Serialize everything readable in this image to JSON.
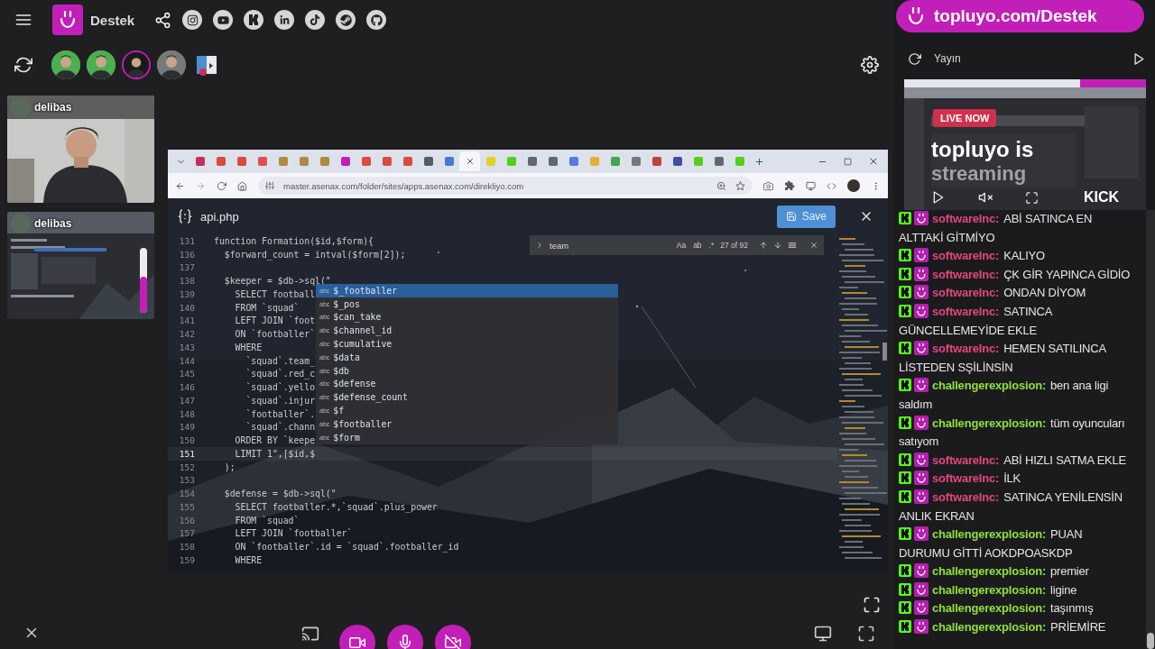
{
  "topbar": {
    "server_name": "Destek",
    "social_links": [
      {
        "kind": "camera"
      },
      {
        "kind": "play"
      },
      {
        "kind": "k"
      },
      {
        "kind": "in"
      },
      {
        "kind": "note"
      },
      {
        "kind": "steam"
      },
      {
        "kind": "cat"
      }
    ]
  },
  "avatars": [
    {
      "kind": "person",
      "selected": false
    },
    {
      "kind": "person",
      "selected": false
    },
    {
      "kind": "person",
      "selected": true
    },
    {
      "kind": "person",
      "selected": false
    },
    {
      "kind": "app",
      "selected": false
    }
  ],
  "video_tiles": [
    {
      "name": "delibas",
      "kind": "camera"
    },
    {
      "name": "delibas",
      "kind": "screen",
      "volume": {
        "level": 0.55
      }
    }
  ],
  "browser": {
    "tabs": [
      {
        "color": "#c0305a",
        "selected": false
      },
      {
        "color": "#d94b3b",
        "selected": false
      },
      {
        "color": "#d94b3b",
        "selected": false
      },
      {
        "color": "#e05050",
        "selected": false
      },
      {
        "color": "#b08a40",
        "selected": false
      },
      {
        "color": "#b08a40",
        "selected": false
      },
      {
        "color": "#b08a40",
        "selected": false
      },
      {
        "color": "#c020b8",
        "selected": false
      },
      {
        "color": "#d94b3b",
        "selected": false
      },
      {
        "color": "#d94b3b",
        "selected": false
      },
      {
        "color": "#d94b3b",
        "selected": false
      },
      {
        "color": "#555a66",
        "selected": false
      },
      {
        "color": "#4a78d0",
        "selected": false
      },
      {
        "selected": true
      },
      {
        "color": "#e8d020",
        "selected": false
      },
      {
        "color": "#53d018",
        "selected": false
      },
      {
        "color": "#606672",
        "selected": false
      },
      {
        "color": "#606672",
        "selected": false
      },
      {
        "color": "#5a7ae0",
        "selected": false
      },
      {
        "color": "#e8b030",
        "selected": false
      },
      {
        "color": "#3fa84a",
        "selected": false
      },
      {
        "color": "#777777",
        "selected": false
      },
      {
        "color": "#c04040",
        "selected": false
      },
      {
        "color": "#4050a0",
        "selected": false
      },
      {
        "color": "#53d018",
        "selected": false
      },
      {
        "color": "#606672",
        "selected": false
      },
      {
        "color": "#53d018",
        "selected": false
      }
    ],
    "url": "master.asenax.com/folder/sites/apps.asenax.com/direkliyo.com"
  },
  "editor": {
    "file_name": "api.php",
    "save_label": "Save",
    "find": {
      "query": "team",
      "toggles": [
        "Aa",
        "ab",
        ".*"
      ],
      "match_count": "27 of 92"
    },
    "lines": [
      {
        "number": "131",
        "code": "function Formation($id,$form){",
        "current": false
      },
      {
        "number": "136",
        "code": "  $forward_count = intval($form[2]);",
        "current": false
      },
      {
        "number": "137",
        "current": false
      },
      {
        "number": "138",
        "code": "  $keeper = $db->sql(\"",
        "current": false
      },
      {
        "number": "139",
        "code": "    SELECT football",
        "current": false
      },
      {
        "number": "140",
        "code": "    FROM `squad`",
        "current": false
      },
      {
        "number": "141",
        "code": "    LEFT JOIN `foot",
        "current": false
      },
      {
        "number": "142",
        "code": "    ON `footballer`",
        "current": false
      },
      {
        "number": "143",
        "code": "    WHERE",
        "current": false
      },
      {
        "number": "144",
        "code": "      `squad`.team_",
        "current": false
      },
      {
        "number": "145",
        "code": "      `squad`.red_c",
        "current": false
      },
      {
        "number": "146",
        "code": "      `squad`.yello",
        "current": false
      },
      {
        "number": "147",
        "code": "      `squad`.injur",
        "current": false
      },
      {
        "number": "148",
        "code": "      `footballer`.",
        "current": false
      },
      {
        "number": "149",
        "code": "      `squad`.chann",
        "current": false
      },
      {
        "number": "150",
        "code": "    ORDER BY `keepe",
        "current": false
      },
      {
        "number": "151",
        "code": "    LIMIT 1\",[$id,$",
        "current": true
      },
      {
        "number": "152",
        "code": "  );",
        "current": false
      },
      {
        "number": "153",
        "current": false
      },
      {
        "number": "154",
        "code": "  $defense = $db->sql(\"",
        "current": false
      },
      {
        "number": "155",
        "code": "    SELECT footballer.*,`squad`.plus_power",
        "current": false
      },
      {
        "number": "156",
        "code": "    FROM `squad`",
        "current": false
      },
      {
        "number": "157",
        "code": "    LEFT JOIN `footballer`",
        "current": false
      },
      {
        "number": "158",
        "code": "    ON `footballer`.id = `squad`.footballer_id",
        "current": false
      },
      {
        "number": "159",
        "code": "    WHERE",
        "current": false
      }
    ],
    "suggestions": [
      {
        "tag": "abc",
        "label": "$_footballer",
        "selected": true
      },
      {
        "tag": "abc",
        "label": "$_pos",
        "selected": false
      },
      {
        "tag": "abc",
        "label": "$can_take",
        "selected": false
      },
      {
        "tag": "abc",
        "label": "$channel_id",
        "selected": false
      },
      {
        "tag": "abc",
        "label": "$cumulative",
        "selected": false
      },
      {
        "tag": "abc",
        "label": "$data",
        "selected": false
      },
      {
        "tag": "abc",
        "label": "$db",
        "selected": false
      },
      {
        "tag": "abc",
        "label": "$defense",
        "selected": false
      },
      {
        "tag": "abc",
        "label": "$defense_count",
        "selected": false
      },
      {
        "tag": "abc",
        "label": "$f",
        "selected": false
      },
      {
        "tag": "abc",
        "label": "$footballer",
        "selected": false
      },
      {
        "tag": "abc",
        "label": "$form",
        "selected": false
      }
    ]
  },
  "side_panel": {
    "link_banner": "topluyo.com/Destek",
    "title": "Yayın",
    "stream": {
      "badge": "LIVE NOW",
      "headline": "topluyo is",
      "subline": "streaming",
      "brand": "KICK"
    },
    "chat": [
      {
        "user": "softwareInc:",
        "color": "#e0477c",
        "text": "ABİ SATINCA EN",
        "continued": "ALTTAKİ GİTMİYO"
      },
      {
        "user": "softwareInc:",
        "color": "#e0477c",
        "text": "KALIYO"
      },
      {
        "user": "softwareInc:",
        "color": "#e0477c",
        "text": "ÇK GİR YAPINCA GİDİO"
      },
      {
        "user": "softwareInc:",
        "color": "#e0477c",
        "text": "ONDAN DİYOM"
      },
      {
        "user": "softwareInc:",
        "color": "#e0477c",
        "text": "SATINCA",
        "continued": "GÜNCELLEMEYİDE EKLE"
      },
      {
        "user": "softwareInc:",
        "color": "#e0477c",
        "text": "HEMEN SATILINCA",
        "continued": "LİSTEDEN SŞİLİNSİN"
      },
      {
        "user": "challengerexplosion:",
        "color": "#8fe03a",
        "text": "ben ana ligi",
        "continued": "saldım"
      },
      {
        "user": "challengerexplosion:",
        "color": "#8fe03a",
        "text": "tüm oyuncuları",
        "continued": "satıyom"
      },
      {
        "user": "softwareInc:",
        "color": "#e0477c",
        "text": "ABİ HIZLI SATMA EKLE"
      },
      {
        "user": "softwareInc:",
        "color": "#e0477c",
        "text": "İLK"
      },
      {
        "user": "softwareInc:",
        "color": "#e0477c",
        "text": "SATINCA YENİLENSİN",
        "continued": "ANLIK EKRAN"
      },
      {
        "user": "challengerexplosion:",
        "color": "#8fe03a",
        "text": "PUAN",
        "continued": "DURUMU GİTTİ AOKDPOASKDP"
      },
      {
        "user": "challengerexplosion:",
        "color": "#8fe03a",
        "text": "premier"
      },
      {
        "user": "challengerexplosion:",
        "color": "#8fe03a",
        "text": "ligine"
      },
      {
        "user": "challengerexplosion:",
        "color": "#8fe03a",
        "text": "taşınmış"
      },
      {
        "user": "challengerexplosion:",
        "color": "#8fe03a",
        "text": "PRİEMİRE"
      }
    ]
  }
}
